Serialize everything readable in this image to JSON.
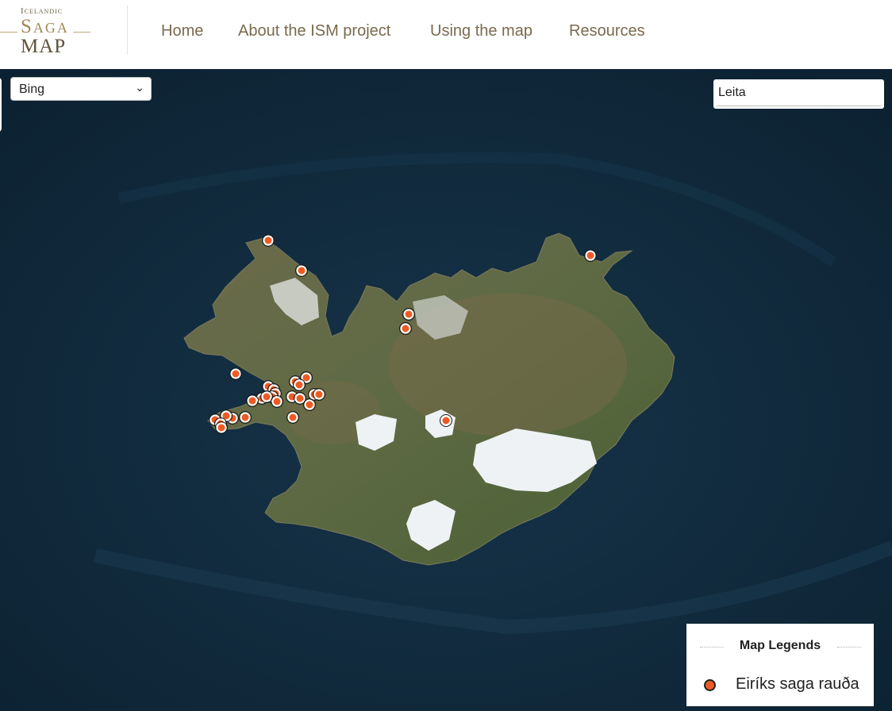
{
  "logo": {
    "line1": "Icelandic",
    "line2": "Saga",
    "line3": "MAP"
  },
  "nav": [
    "Home",
    "About the ISM project",
    "Using the map",
    "Resources"
  ],
  "layer_select": {
    "value": "Bing"
  },
  "search": {
    "value": "Leita"
  },
  "legend": {
    "title": "Map Legends",
    "items": [
      {
        "label": "Eiríks saga rauða",
        "color": "#ee5a24"
      }
    ]
  },
  "colors": {
    "marker_fill": "#ee5a24",
    "marker_stroke": "#ffffff",
    "ocean": "#10283a",
    "land": "#5b6a42",
    "ice": "#eef2f4",
    "nav_text": "#7a6a4f"
  }
}
